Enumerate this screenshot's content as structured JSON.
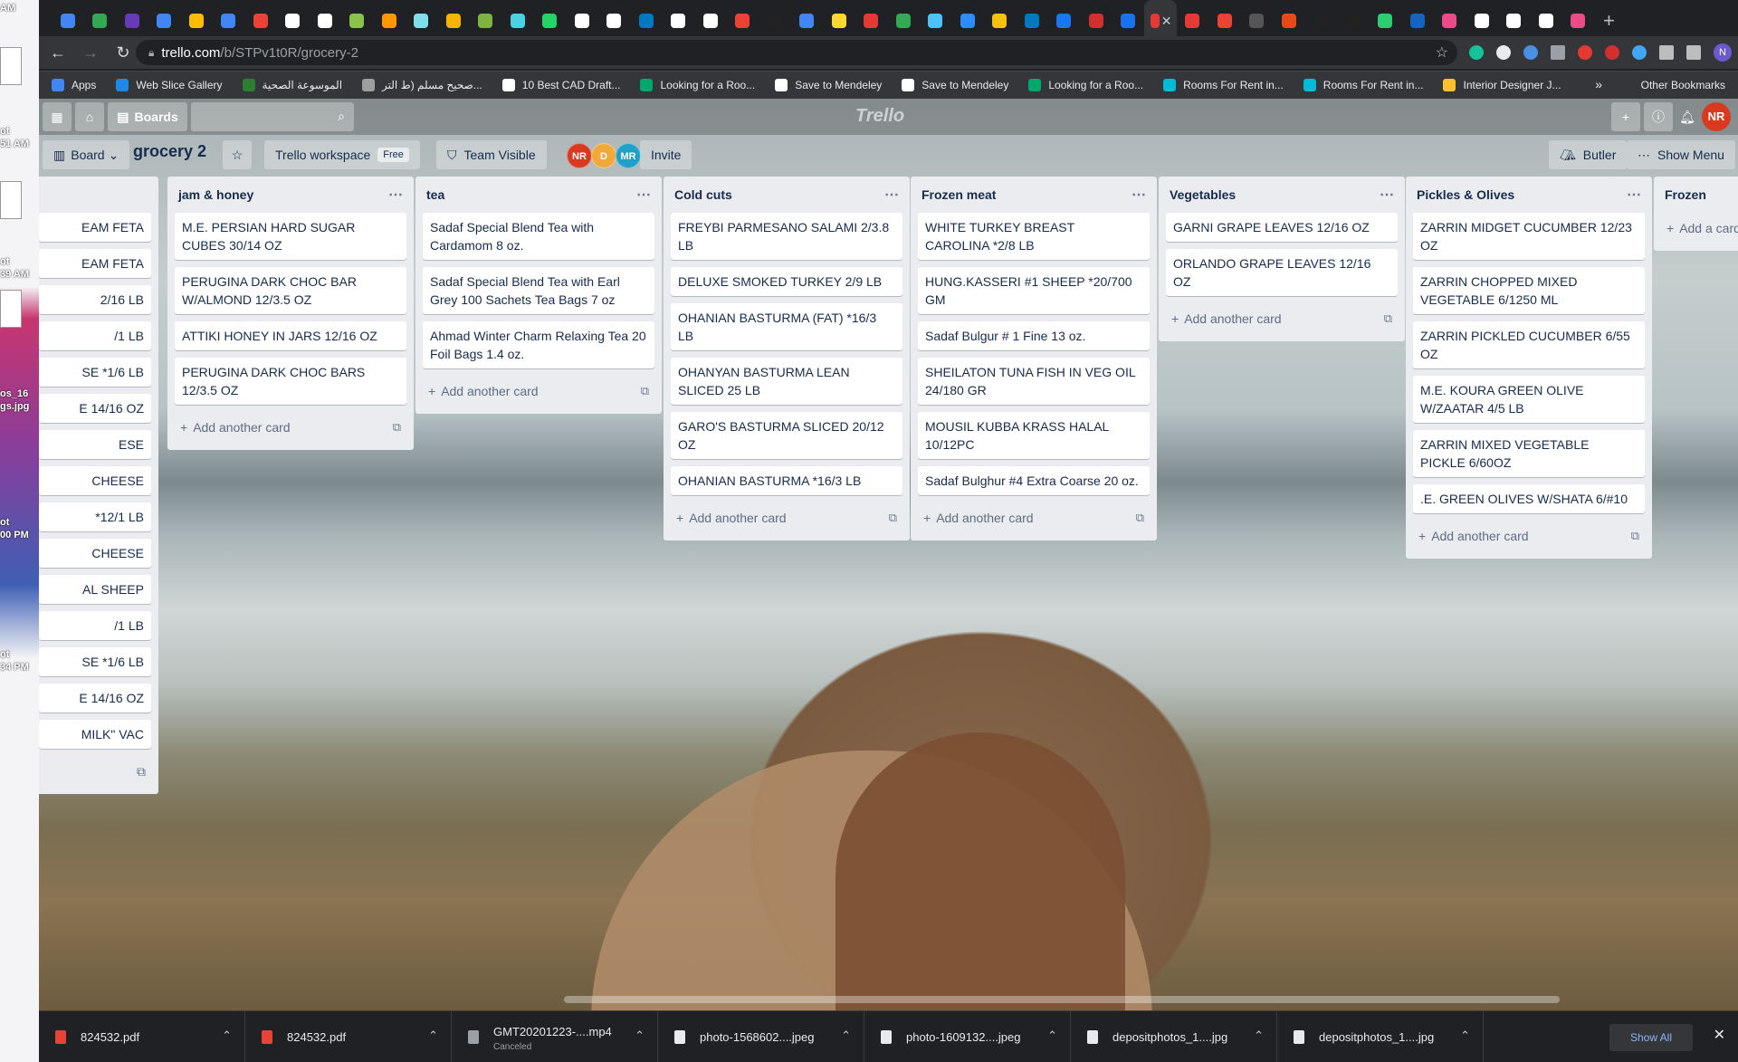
{
  "desktop": {
    "items": [
      {
        "label": "AM"
      },
      {
        "label": "ot\n51 AM"
      },
      {
        "label": "ot\n39 AM"
      },
      {
        "label": "os_16\ngs.jpg"
      },
      {
        "label": "ot\n00 PM"
      },
      {
        "label": "ot\n34 PM"
      }
    ]
  },
  "browser": {
    "url_host": "trello.com",
    "url_path": "/b/STPv1t0R/grocery-2",
    "profile_initial": "N",
    "bookmarks": [
      {
        "label": "Apps",
        "color": "#4285f4"
      },
      {
        "label": "Web Slice Gallery",
        "color": "#1e88e5"
      },
      {
        "label": "الموسوعة الصحية",
        "color": "#2e7d32"
      },
      {
        "label": "صحيح مسلم (ط التر...",
        "color": "#9e9e9e"
      },
      {
        "label": "10 Best CAD Draft...",
        "color": "#ffffff"
      },
      {
        "label": "Looking for a Roo...",
        "color": "#00a86b"
      },
      {
        "label": "Save to Mendeley",
        "color": "#ffffff"
      },
      {
        "label": "Save to Mendeley",
        "color": "#ffffff"
      },
      {
        "label": "Looking for a Roo...",
        "color": "#00a86b"
      },
      {
        "label": "Rooms For Rent in...",
        "color": "#00bcd4"
      },
      {
        "label": "Rooms For Rent in...",
        "color": "#00bcd4"
      },
      {
        "label": "Interior Designer J...",
        "color": "#fbc02d"
      }
    ],
    "bookmarks_more": "»",
    "other_bookmarks": "Other Bookmarks",
    "tab_colors": [
      "#4285f4",
      "#34a853",
      "#673ab7",
      "#4285f4",
      "#fbbc04",
      "#4285f4",
      "#ea4335",
      "#ffffff",
      "#ffffff",
      "#8bc34a",
      "#ff9800",
      "#80deea",
      "#f4b400",
      "#7cb342",
      "#4dd0e1",
      "#25d366",
      "#ffffff",
      "#ffffff",
      "#0079bf",
      "#ffffff",
      "#ffffff",
      "#ea4335",
      "#222222",
      "#4285f4",
      "#fdd835",
      "#e53935",
      "#34a853",
      "#4fc3f7",
      "#2d8cff",
      "#f4c20d",
      "#0079bf",
      "#1877f2",
      "#d32f2f",
      "#1a73e8",
      "#e53935",
      "#e53935",
      "#ea4335",
      "#555555",
      "#e64a19",
      "#222222",
      "#222222",
      "#2ecc71",
      "#1565c0",
      "#ea4c89",
      "#ffffff",
      "#ffffff",
      "#ffffff",
      "#ea4c89"
    ]
  },
  "trello": {
    "logo": "Trello",
    "header": {
      "boards_label": "Boards",
      "user_initials": "NR"
    },
    "board": {
      "view_label": "Board",
      "title": "grocery 2",
      "workspace_label": "Trello workspace",
      "workspace_badge": "Free",
      "visibility_label": "Team Visible",
      "members": [
        {
          "initials": "NR",
          "color": "#d93a1f"
        },
        {
          "initials": "D",
          "color": "#f2a93b"
        },
        {
          "initials": "MR",
          "color": "#1ea0c8"
        }
      ],
      "invite_label": "Invite",
      "butler_label": "Butler",
      "show_menu_label": "Show Menu"
    },
    "partial_list": {
      "cards": [
        "EAM FETA",
        "EAM FETA",
        "2/16 LB",
        "/1 LB",
        "SE *1/6 LB",
        "E 14/16 OZ",
        "ESE",
        "CHEESE",
        " *12/1 LB",
        "CHEESE",
        "AL SHEEP",
        "/1 LB",
        "SE *1/6 LB",
        "E 14/16 OZ",
        "MILK\" VAC"
      ]
    },
    "lists": [
      {
        "title": "jam & honey",
        "cards": [
          "M.E. PERSIAN HARD SUGAR CUBES 30/14 OZ",
          "PERUGINA DARK CHOC BAR W/ALMOND 12/3.5 OZ",
          "ATTIKI HONEY IN JARS 12/16 OZ",
          "PERUGINA DARK CHOC BARS 12/3.5 OZ"
        ],
        "add_label": "Add another card"
      },
      {
        "title": "tea",
        "cards": [
          "Sadaf Special Blend Tea with Cardamom 8 oz.",
          "Sadaf Special Blend Tea with Earl Grey 100 Sachets Tea Bags 7 oz",
          "Ahmad Winter Charm Relaxing Tea 20 Foil Bags 1.4 oz."
        ],
        "add_label": "Add another card"
      },
      {
        "title": "Cold cuts",
        "cards": [
          "FREYBI PARMESANO SALAMI 2/3.8 LB",
          "DELUXE SMOKED TURKEY 2/9 LB",
          "OHANIAN BASTURMA (FAT) *16/3 LB",
          "OHANYAN BASTURMA LEAN SLICED 25 LB",
          "GARO'S BASTURMA SLICED 20/12 OZ",
          "OHANIAN BASTURMA *16/3 LB"
        ],
        "add_label": "Add another card"
      },
      {
        "title": "Frozen meat",
        "cards": [
          "WHITE TURKEY BREAST CAROLINA *2/8 LB",
          "HUNG.KASSERI #1 SHEEP *20/700 GM",
          "Sadaf Bulgur # 1 Fine 13 oz.",
          "SHEILATON TUNA FISH IN VEG OIL 24/180 GR",
          "MOUSIL KUBBA KRASS HALAL 10/12PC",
          "Sadaf Bulghur #4 Extra Coarse 20 oz."
        ],
        "add_label": "Add another card"
      },
      {
        "title": "Vegetables",
        "cards": [
          "GARNI GRAPE LEAVES 12/16 OZ",
          "ORLANDO GRAPE LEAVES 12/16 OZ"
        ],
        "add_label": "Add another card"
      },
      {
        "title": "Pickles & Olives",
        "cards": [
          "ZARRIN MIDGET CUCUMBER 12/23 OZ",
          "ZARRIN CHOPPED MIXED VEGETABLE 6/1250 ML",
          "ZARRIN PICKLED CUCUMBER 6/55 OZ",
          "M.E. KOURA GREEN OLIVE W/ZAATAR 4/5 LB",
          "ZARRIN MIXED VEGETABLE PICKLE 6/60OZ",
          ".E. GREEN OLIVES W/SHATA 6/#10"
        ],
        "add_label": "Add another card"
      },
      {
        "title": "Frozen",
        "cards": [],
        "add_label": "Add a card"
      }
    ]
  },
  "downloads": {
    "items": [
      {
        "name": "824532.pdf",
        "sub": "",
        "color": "#ea4335"
      },
      {
        "name": "824532.pdf",
        "sub": "",
        "color": "#ea4335"
      },
      {
        "name": "GMT20201223-....mp4",
        "sub": "Canceled",
        "color": "#9aa0a6"
      },
      {
        "name": "photo-1568602....jpeg",
        "sub": "",
        "color": "#e8eaed"
      },
      {
        "name": "photo-1609132....jpeg",
        "sub": "",
        "color": "#e8eaed"
      },
      {
        "name": "depositphotos_1....jpg",
        "sub": "",
        "color": "#e8eaed"
      },
      {
        "name": "depositphotos_1....jpg",
        "sub": "",
        "color": "#e8eaed"
      }
    ],
    "show_all_label": "Show All"
  }
}
